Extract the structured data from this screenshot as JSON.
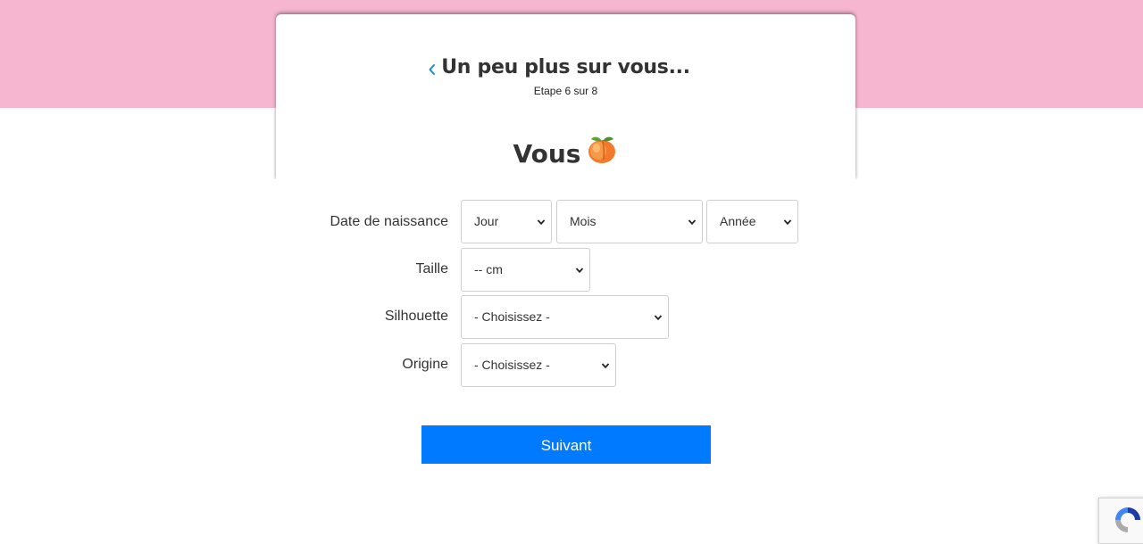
{
  "header": {
    "title": "Un peu plus sur vous...",
    "step": "Etape 6 sur 8",
    "back_icon": "chevron-left-icon",
    "accent_color": "#1c8ad4",
    "band_color": "#f7b6cf"
  },
  "section": {
    "title": "Vous",
    "emoji_icon": "peach-emoji-icon"
  },
  "form": {
    "birthdate": {
      "label": "Date de naissance",
      "day": "Jour",
      "month": "Mois",
      "year": "Année"
    },
    "height": {
      "label": "Taille",
      "value": "-- cm"
    },
    "silhouette": {
      "label": "Silhouette",
      "value": "- Choisissez -"
    },
    "origin": {
      "label": "Origine",
      "value": "- Choisissez -"
    },
    "submit_label": "Suivant",
    "submit_color": "#007bff"
  },
  "recaptcha_icon": "recaptcha-icon"
}
